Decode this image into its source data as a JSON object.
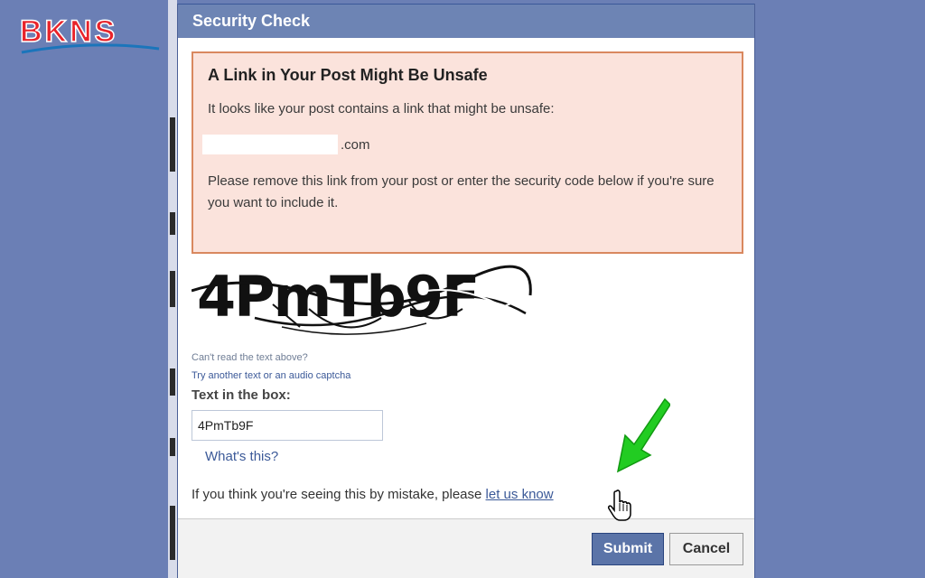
{
  "logo": {
    "text": "BKNS",
    "colors": {
      "letters": "#e8232a",
      "swoosh": "#1b75bb"
    }
  },
  "dialog": {
    "title": "Security Check",
    "warning": {
      "title": "A Link in Your Post Might Be Unsafe",
      "intro": "It looks like your post contains a link that might be unsafe:",
      "link_suffix": ".com",
      "instruction": "Please remove this link from your post or enter the security code below if you're sure you want to include it."
    },
    "captcha": {
      "image_text": "4PmTb9F",
      "cant_read": "Can't read the text above?",
      "alternatives": "Try another text or an audio captcha"
    },
    "field": {
      "label": "Text in the box:",
      "value": "4PmTb9F"
    },
    "whats_this": "What's this?",
    "mistake": {
      "prefix": "If you think you're seeing this by mistake, please ",
      "link": "let us know"
    },
    "buttons": {
      "submit": "Submit",
      "cancel": "Cancel"
    }
  },
  "colors": {
    "page_background": "#6b7fb5",
    "header_background": "#6d84b4",
    "warning_background": "#fbe3dc",
    "warning_border": "#d9885f",
    "link": "#3b5998",
    "annotation_arrow": "#22cc22"
  },
  "icons": [
    "green-arrow-icon",
    "hand-cursor-icon"
  ]
}
